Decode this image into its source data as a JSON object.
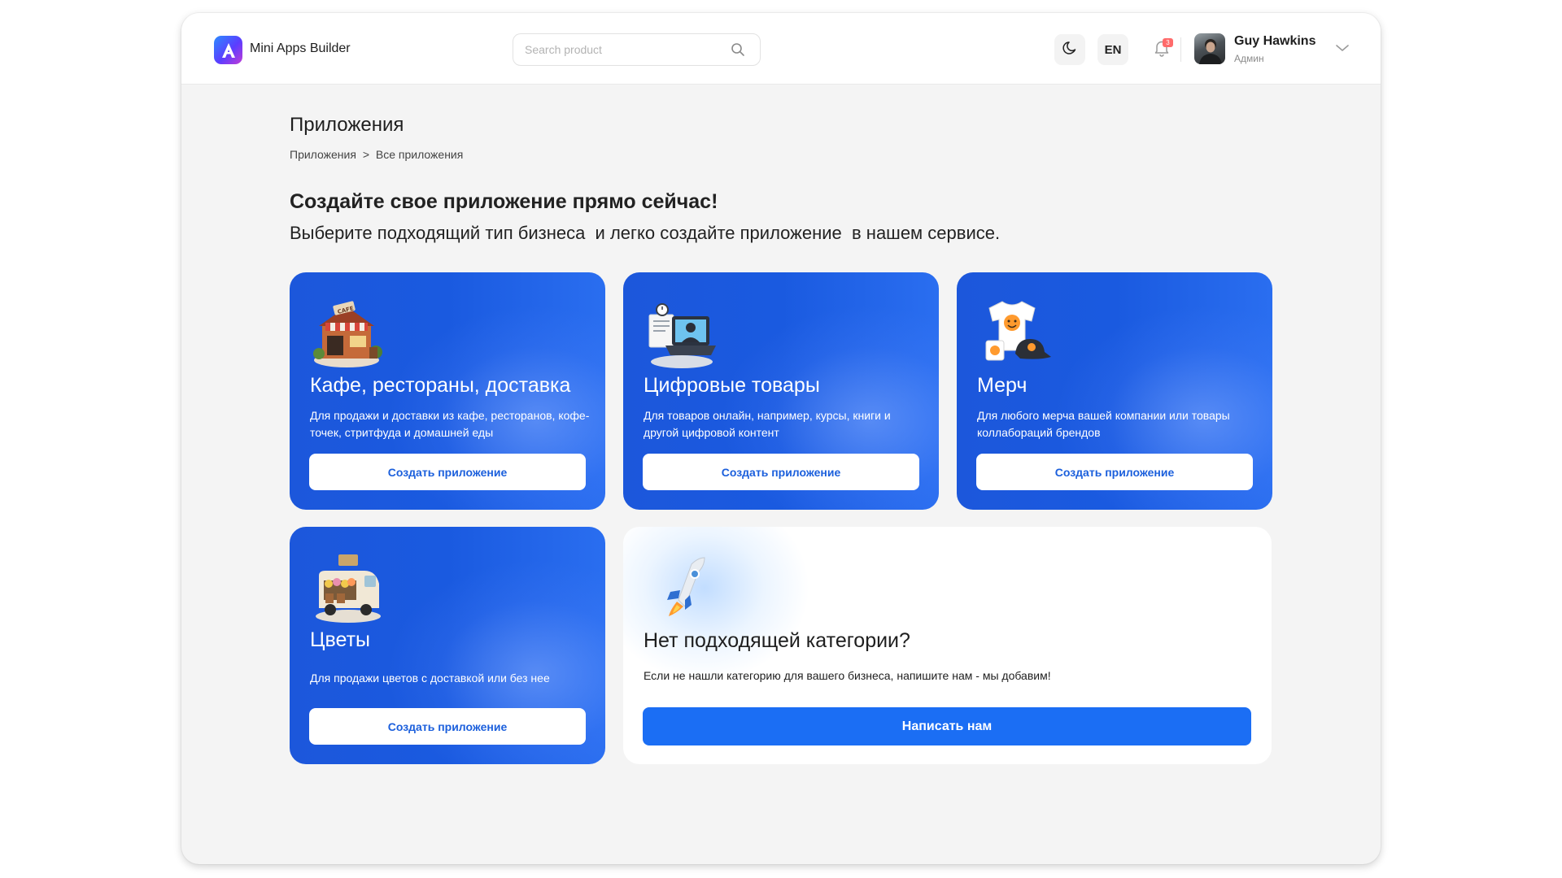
{
  "header": {
    "app_name": "Mini Apps Builder",
    "search_placeholder": "Search product",
    "language": "EN",
    "notifications_count": "3",
    "user_name": "Guy Hawkins",
    "user_role": "Админ",
    "icons": [
      "logo-icon",
      "search-icon",
      "moon-icon",
      "bell-icon",
      "chevron-down-icon"
    ]
  },
  "page": {
    "title": "Приложения",
    "breadcrumb": [
      "Приложения",
      "Все приложения"
    ],
    "breadcrumb_separator": ">",
    "headline": "Создайте свое приложение прямо сейчас!",
    "subline": "Выберите подходящий тип бизнеса  и легко создайте приложение  в нашем сервисе."
  },
  "cards": [
    {
      "title": "Кафе, рестораны, доставка",
      "description": "Для продажи и доставки из кафе, ресторанов, кофе-точек, стритфуда и домашней еды",
      "button": "Создать приложение",
      "image": "cafe-illustration"
    },
    {
      "title": "Цифровые товары",
      "description": "Для товаров онлайн, например, курсы, книги и другой цифровой контент",
      "button": "Создать приложение",
      "image": "laptop-illustration"
    },
    {
      "title": "Мерч",
      "description": "Для любого мерча вашей компании или товары коллабораций брендов",
      "button": "Создать приложение",
      "image": "merch-illustration"
    },
    {
      "title": "Цветы",
      "description": "Для продажи цветов с доставкой или без нее",
      "button": "Создать приложение",
      "image": "flower-van-illustration"
    }
  ],
  "no_category": {
    "title": "Нет подходящей категории?",
    "description": "Если не нашли категорию для вашего бизнеса, напишите нам - мы добавим!",
    "button": "Написать нам",
    "image": "rocket-illustration"
  },
  "colors": {
    "card_blue": "#1c57db",
    "primary_button": "#1b6ef4",
    "page_bg": "#f4f4f4"
  }
}
